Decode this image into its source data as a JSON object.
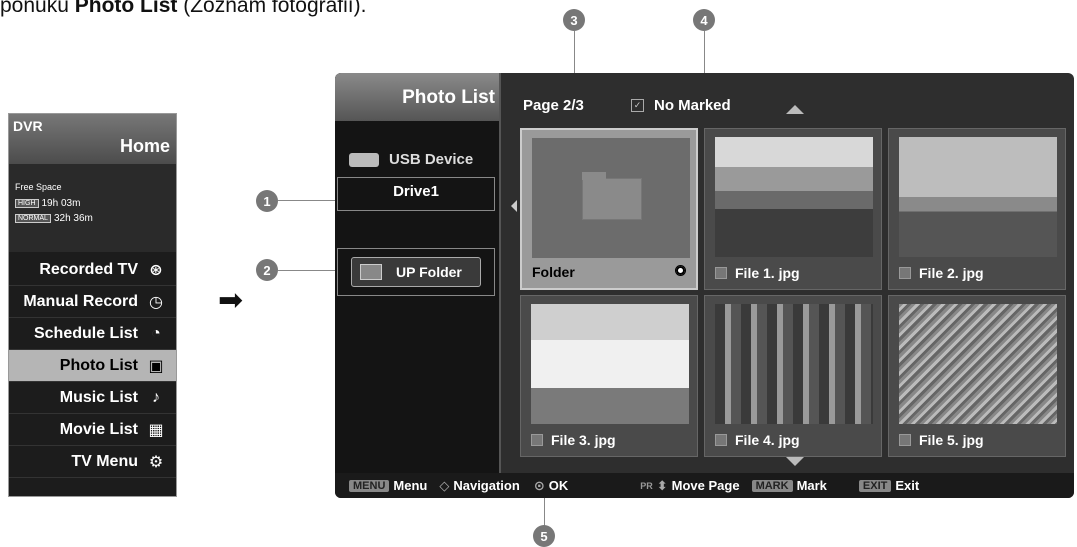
{
  "intro": {
    "text_prefix": "ponuku ",
    "text_bold": "Photo List",
    "text_suffix": " (Zoznam fotografií)."
  },
  "callouts": [
    "1",
    "2",
    "3",
    "4",
    "5"
  ],
  "dvr": {
    "label": "DVR",
    "home": "Home",
    "free_space_label": "Free Space",
    "high_tag": "HIGH",
    "high_time": "19h 03m",
    "normal_tag": "NORMAL",
    "normal_time": "32h 36m",
    "menu": [
      {
        "label": "Recorded TV",
        "icon": "film-reel-icon",
        "glyph": "⊛"
      },
      {
        "label": "Manual Record",
        "icon": "clock-record-icon",
        "glyph": "◷"
      },
      {
        "label": "Schedule List",
        "icon": "schedule-clock-icon",
        "glyph": "◔"
      },
      {
        "label": "Photo List",
        "icon": "photo-icon",
        "glyph": "▣"
      },
      {
        "label": "Music List",
        "icon": "music-note-icon",
        "glyph": "♪"
      },
      {
        "label": "Movie List",
        "icon": "movie-icon",
        "glyph": "▦"
      },
      {
        "label": "TV Menu",
        "icon": "gears-icon",
        "glyph": "⚙"
      }
    ],
    "active_index": 3
  },
  "photo_list": {
    "title": "Photo List",
    "device": "USB Device",
    "drive": "Drive1",
    "up_folder": "UP Folder",
    "page": "Page 2/3",
    "marked": "No Marked",
    "items": [
      {
        "label": "Folder"
      },
      {
        "label": "File 1. jpg"
      },
      {
        "label": "File 2. jpg"
      },
      {
        "label": "File 3. jpg"
      },
      {
        "label": "File 4. jpg"
      },
      {
        "label": "File 5. jpg"
      }
    ]
  },
  "bottom_bar": {
    "menu_key": "MENU",
    "menu_label": "Menu",
    "nav_label": "Navigation",
    "ok_label": "OK",
    "pr_key": "PR",
    "move_label": "Move Page",
    "mark_key": "MARK",
    "mark_label": "Mark",
    "exit_key": "EXIT",
    "exit_label": "Exit"
  }
}
